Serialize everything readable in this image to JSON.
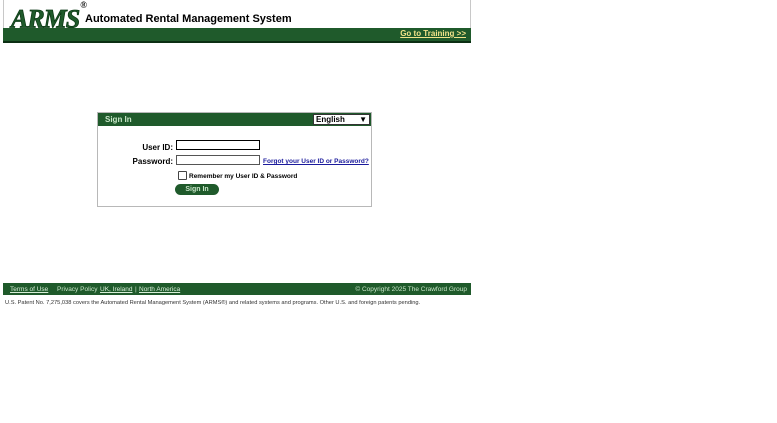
{
  "header": {
    "logo_text": "ARMS",
    "logo_mark": "®",
    "title": "Automated Rental Management System",
    "training_link": "Go to Training >>"
  },
  "signin": {
    "panel_title": "Sign In",
    "language": {
      "selected": "English"
    },
    "user_id_label": "User ID:",
    "password_label": "Password:",
    "forgot_link": "Forgot your User ID or Password?",
    "remember_label": "Remember my User ID & Password",
    "remember_checked": false,
    "button_label": "Sign In",
    "user_id_value": "",
    "password_value": ""
  },
  "footer": {
    "terms": "Terms of Use",
    "privacy_prefix": "Privacy Policy",
    "privacy_uk": "UK, Ireland",
    "separator": "|",
    "privacy_na": "North America",
    "copyright": "© Copyright  2025  The Crawford Group",
    "patent": "U.S. Patent No. 7,275,038 covers the Automated Rental Management System (ARMS®) and related systems and programs. Other U.S. and foreign patents pending."
  },
  "colors": {
    "brand_green": "#1f5a2b",
    "link_yellow": "#f3e38a",
    "link_blue": "#1a1a9c"
  }
}
